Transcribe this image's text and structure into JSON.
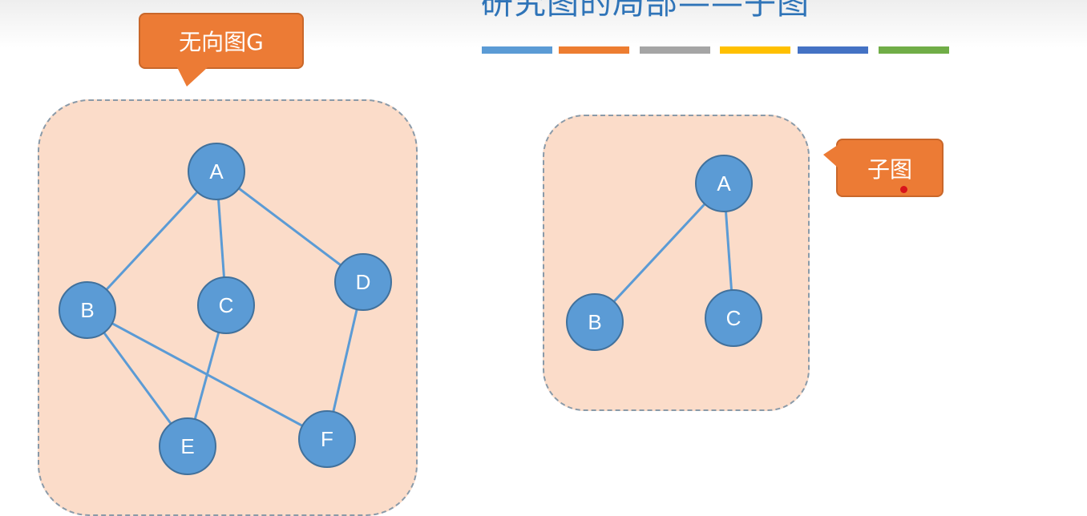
{
  "slide": {
    "title": "研究图的局部——子图",
    "bar_colors": [
      "#5b9bd5",
      "#ed7d31",
      "#a5a5a5",
      "#ffc000",
      "#4472c4",
      "#70ad47"
    ]
  },
  "callouts": {
    "graph_label": "无向图G",
    "subgraph_label": "子图"
  },
  "style": {
    "node_fill": "#5b9bd5",
    "node_stroke": "#41719c",
    "edge_color": "#5b9bd5",
    "panel_fill": "#fbdcc9",
    "callout_fill": "#ec7b35"
  },
  "graph_g": {
    "nodes": [
      {
        "id": "A",
        "label": "A"
      },
      {
        "id": "B",
        "label": "B"
      },
      {
        "id": "C",
        "label": "C"
      },
      {
        "id": "D",
        "label": "D"
      },
      {
        "id": "E",
        "label": "E"
      },
      {
        "id": "F",
        "label": "F"
      }
    ],
    "edges": [
      [
        "A",
        "B"
      ],
      [
        "A",
        "C"
      ],
      [
        "A",
        "D"
      ],
      [
        "B",
        "E"
      ],
      [
        "B",
        "F"
      ],
      [
        "C",
        "E"
      ],
      [
        "D",
        "F"
      ]
    ]
  },
  "subgraph": {
    "nodes": [
      {
        "id": "A",
        "label": "A"
      },
      {
        "id": "B",
        "label": "B"
      },
      {
        "id": "C",
        "label": "C"
      }
    ],
    "edges": [
      [
        "A",
        "B"
      ],
      [
        "A",
        "C"
      ]
    ]
  }
}
